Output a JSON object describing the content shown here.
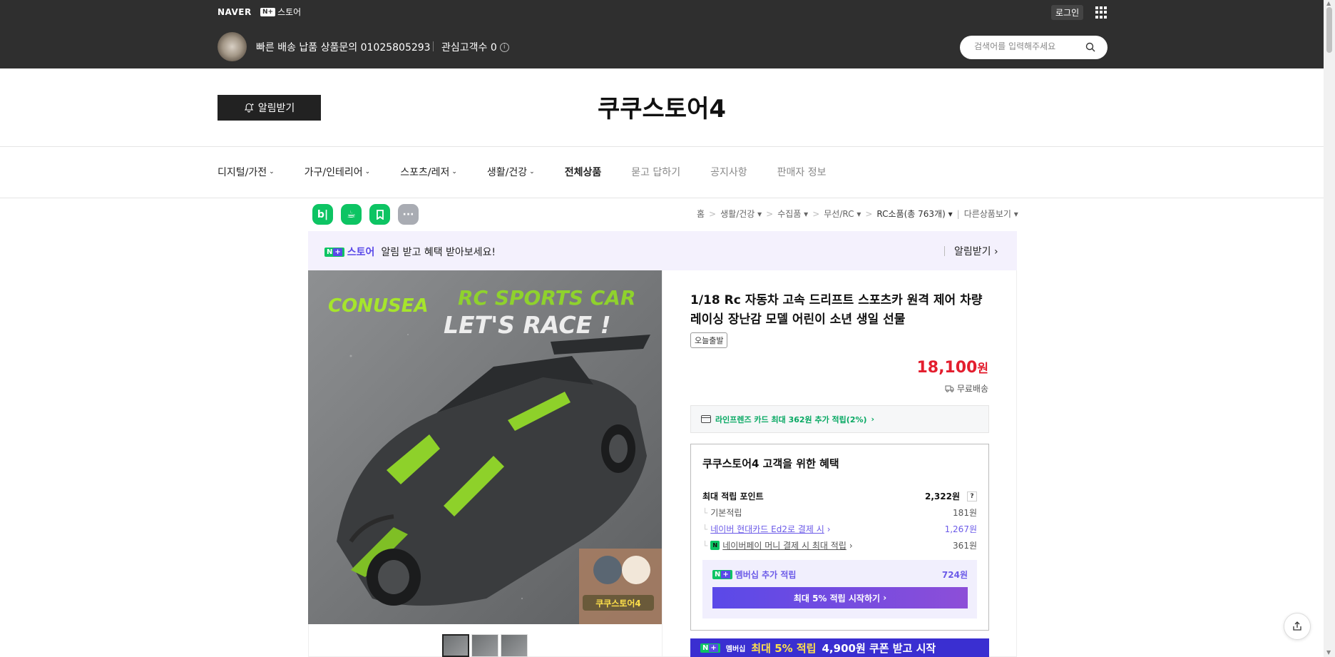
{
  "gnb": {
    "naver_logo": "NAVER",
    "npay_box": "N+",
    "npay_label": "스토어",
    "login": "로그인"
  },
  "store_header": {
    "description": "빠른 배송 납품 상품문의 01025805293",
    "interest": "관심고객수 0",
    "search_placeholder": "검색어를 입력해주세요",
    "notify_button": "알림받기",
    "title": "쿠쿠스토어4"
  },
  "nav": {
    "items": [
      {
        "label": "디지털/가전",
        "dropdown": true
      },
      {
        "label": "가구/인테리어",
        "dropdown": true
      },
      {
        "label": "스포츠/레저",
        "dropdown": true
      },
      {
        "label": "생활/건강",
        "dropdown": true
      },
      {
        "label": "전체상품"
      },
      {
        "label": "묻고 답하기"
      },
      {
        "label": "공지사항"
      },
      {
        "label": "판매자 정보"
      }
    ]
  },
  "share_icons": [
    "blog-icon",
    "cafe-icon",
    "bookmark-icon",
    "more-icon"
  ],
  "breadcrumb": {
    "home": "홈",
    "c1": "생활/건강",
    "c2": "수집품",
    "c3": "무선/RC",
    "c4": "RC소품(총 763개)",
    "c5": "다른상품보기"
  },
  "banner": {
    "logo_box": "N+",
    "store": "스토어",
    "text": "알림 받고 혜택 받아보세요!",
    "action": "알림받기"
  },
  "product": {
    "title": "1/18 Rc 자동차 고속 드리프트 스포츠카 원격 제어 차량 레이싱 장난감 모델 어린이 소년 생일 선물",
    "badge": "오늘출발",
    "price": "18,100",
    "price_unit": "원",
    "shipping": "무료배송",
    "card_benefit": "라인프렌즈 카드 최대 362원 추가 적립(2%)",
    "image_texts": {
      "brand": "CONUSEA",
      "headline1": "RC SPORTS CAR",
      "headline2": "LET'S RACE !",
      "sticker": "쿠쿠스토어4"
    }
  },
  "benefit": {
    "title": "쿠쿠스토어4 고객을 위한 혜택",
    "max_points_label": "최대 적립 포인트",
    "max_points_value": "2,322원",
    "help": "?",
    "rows": [
      {
        "label": "기본적립",
        "value": "181원"
      },
      {
        "label": "네이버 현대카드 Ed2로 결제 시",
        "value": "1,267원"
      },
      {
        "label": "네이버페이 머니 결제 시 최대 적립",
        "value": "361원"
      }
    ],
    "membership_label": "멤버십 추가 적립",
    "membership_value": "724원",
    "membership_cta": "최대 5% 적립 시작하기"
  },
  "promo": {
    "badge": "멤버십",
    "text_yellow": "최대 5% 적립",
    "text": "4,900원 쿠폰 받고 시작"
  },
  "colors": {
    "header_bg": "#2f2f2f",
    "price_red": "#e31e2e",
    "naver_green": "#0dc463",
    "membership_purple": "#5a49e8"
  }
}
